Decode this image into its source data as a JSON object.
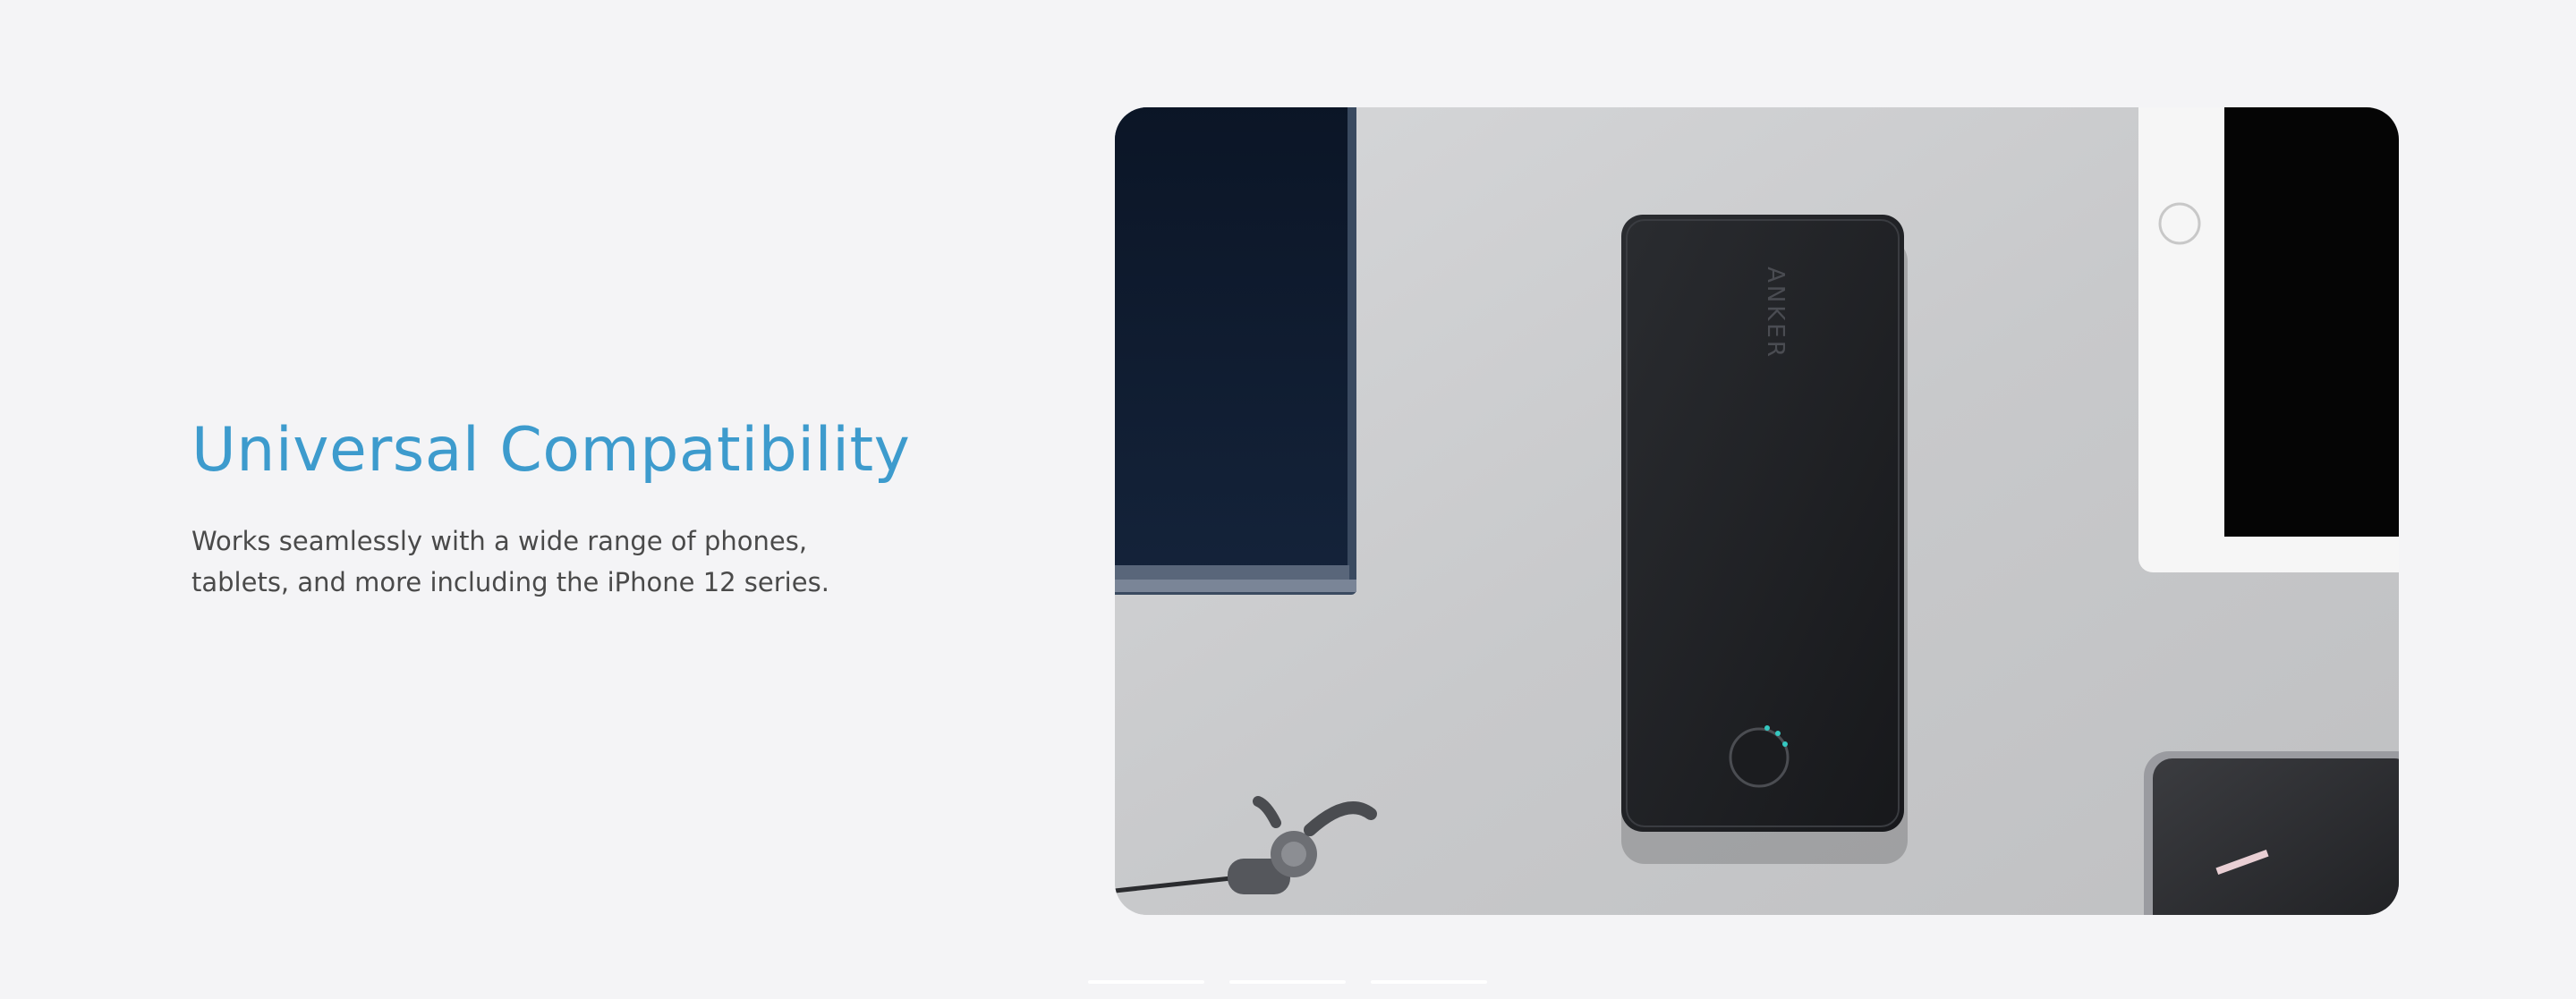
{
  "feature": {
    "heading": "Universal Compatibility",
    "description_line1": "Works seamlessly with a wide range of phones,",
    "description_line2": "tablets, and more including the iPhone 12 series.",
    "accent_color": "#3d9bcd"
  },
  "product_image": {
    "brand_text": "ANKER"
  },
  "carousel": {
    "slide_count": 3
  }
}
